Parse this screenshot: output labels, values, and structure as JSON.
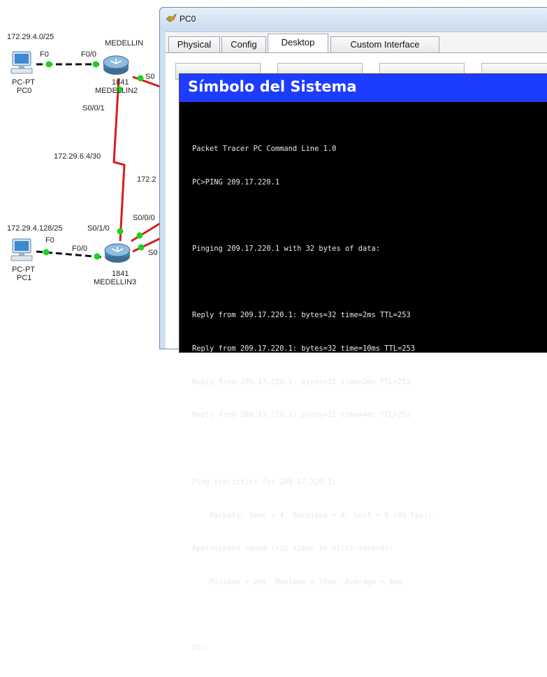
{
  "topology": {
    "networks": {
      "net_pc0": "172.29.4.0/25",
      "net_pc1": "172.29.4.128/25",
      "net_link": "172.29.6.4/30",
      "net_partial": "172.2"
    },
    "routers": [
      {
        "name": "MEDELLIN",
        "model": "1841",
        "hostname": "MEDELLIN2"
      },
      {
        "model": "1841",
        "hostname": "MEDELLIN3"
      }
    ],
    "pcs": [
      {
        "type": "PC-PT",
        "name": "PC0"
      },
      {
        "type": "PC-PT",
        "name": "PC1"
      }
    ],
    "interfaces": {
      "pc0_f0": "F0",
      "r2_f00": "F0/0",
      "r2_s0_partial": "S0",
      "r2_s001": "S0/0/1",
      "r3_s000": "S0/0/0",
      "r3_s010": "S0/1/0",
      "r3_s0_partial": "S0",
      "pc1_f0": "F0",
      "r3_f00": "F0/0"
    },
    "colors": {
      "serial_link": "#d91c1c",
      "ethernet_link": "#111111",
      "link_up": "#1ed11e"
    }
  },
  "window": {
    "title": "PC0",
    "tabs": [
      {
        "label": "Physical",
        "active": false
      },
      {
        "label": "Config",
        "active": false
      },
      {
        "label": "Desktop",
        "active": true
      },
      {
        "label": "Custom Interface",
        "active": false
      }
    ]
  },
  "cmd": {
    "title": "Símbolo del Sistema",
    "title_bg": "#1e3cff",
    "lines": [
      "Packet Tracer PC Command Line 1.0",
      "PC>PING 209.17.220.1",
      "",
      "Pinging 209.17.220.1 with 32 bytes of data:",
      "",
      "Reply from 209.17.220.1: bytes=32 time=2ms TTL=253",
      "Reply from 209.17.220.1: bytes=32 time=10ms TTL=253",
      "Reply from 209.17.220.1: bytes=32 time=2ms TTL=253",
      "Reply from 209.17.220.1: bytes=32 time=4ms TTL=253",
      "",
      "Ping statistics for 209.17.220.1:",
      "    Packets: Sent = 4, Received = 4, Lost = 0 (0% loss),",
      "Approximate round trip times in milli-seconds:",
      "    Minimum = 2ms, Maximum = 10ms, Average = 4ms",
      ""
    ],
    "prompt": "PC>"
  }
}
